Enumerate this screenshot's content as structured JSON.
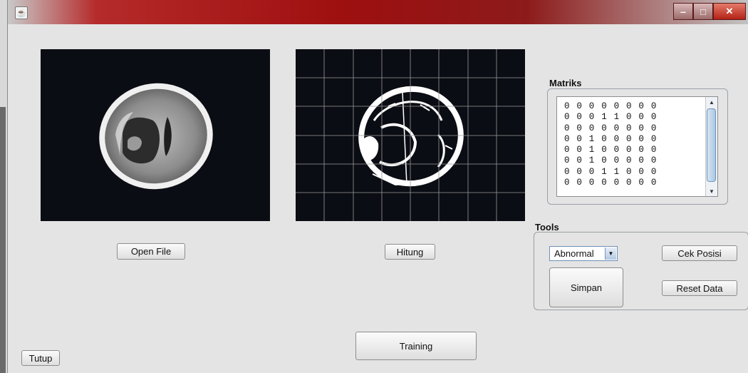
{
  "window": {
    "title": "",
    "controls": {
      "minimize_icon": "minimize-icon",
      "maximize_icon": "maximize-icon",
      "close_icon": "close-icon"
    }
  },
  "images": {
    "original_label": "brain CT scan",
    "processed_label": "binarized brain CT with 8x8 grid",
    "grid": {
      "cols": 8,
      "rows": 6
    }
  },
  "buttons": {
    "open_file": "Open File",
    "hitung": "Hitung",
    "training": "Training",
    "tutup": "Tutup",
    "cek_posisi": "Cek Posisi",
    "simpan": "Simpan",
    "reset_data": "Reset Data"
  },
  "matriks": {
    "title": "Matriks",
    "rows": [
      "00000000",
      "00011000",
      "00000000",
      "00100000",
      "00100000",
      "00100000",
      "00011000",
      "00000000"
    ]
  },
  "tools": {
    "title": "Tools",
    "combo_selected": "Abnormal"
  },
  "colors": {
    "title_bar": "#9e0f10",
    "window_bg": "#e4e4e4",
    "image_bg": "#0b0d14"
  }
}
